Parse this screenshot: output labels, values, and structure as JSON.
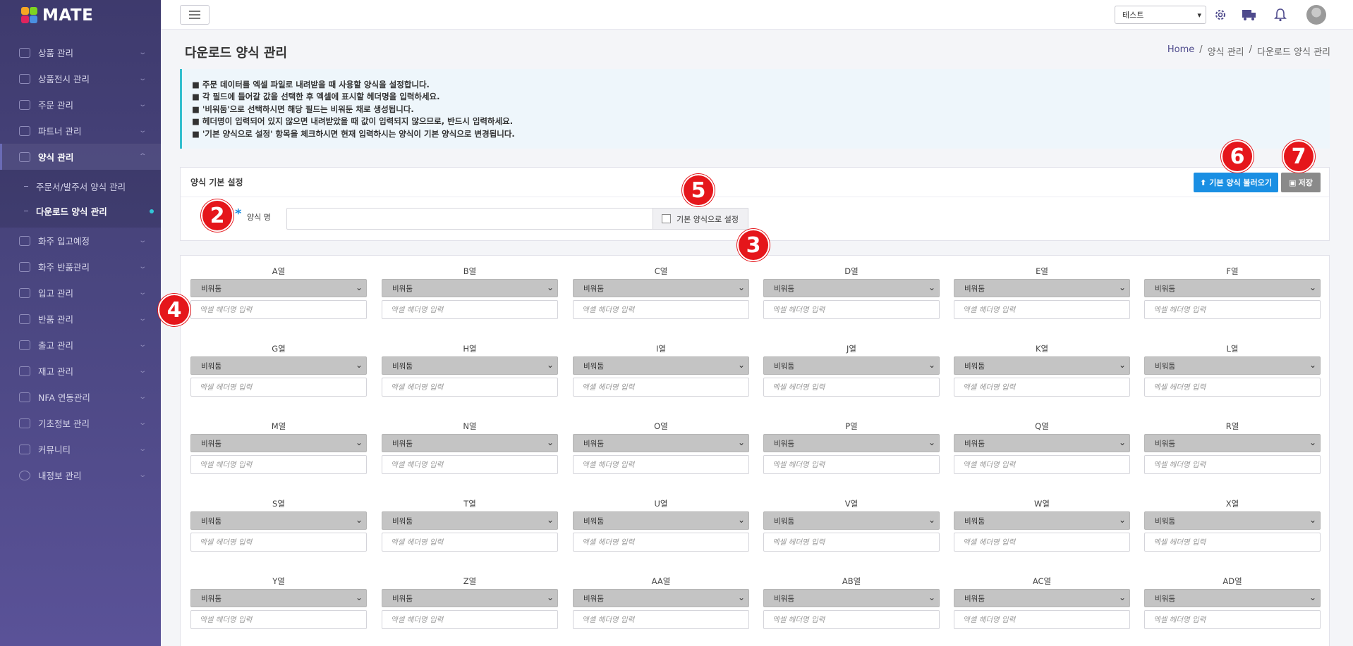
{
  "app": {
    "logo_text": "MATE"
  },
  "sidebar": {
    "items": [
      {
        "label": "상품 관리",
        "icon": "box-icon"
      },
      {
        "label": "상품전시 관리",
        "icon": "display-icon"
      },
      {
        "label": "주문 관리",
        "icon": "cart-icon"
      },
      {
        "label": "파트너 관리",
        "icon": "handshake-icon"
      },
      {
        "label": "양식 관리",
        "icon": "document-icon"
      },
      {
        "label": "화주 입고예정",
        "icon": "truck-in-icon"
      },
      {
        "label": "화주 반품관리",
        "icon": "return-icon"
      },
      {
        "label": "입고 관리",
        "icon": "inbound-icon"
      },
      {
        "label": "반품 관리",
        "icon": "exchange-icon"
      },
      {
        "label": "출고 관리",
        "icon": "truck-icon"
      },
      {
        "label": "재고 관리",
        "icon": "stock-icon"
      },
      {
        "label": "NFA 연동관리",
        "icon": "link-icon"
      },
      {
        "label": "기초정보 관리",
        "icon": "wrench-icon"
      },
      {
        "label": "커뮤니티",
        "icon": "chat-icon"
      },
      {
        "label": "내정보 관리",
        "icon": "info-icon"
      }
    ],
    "submenu": [
      {
        "label": "주문서/발주서 양식 관리"
      },
      {
        "label": "다운로드 양식 관리"
      }
    ]
  },
  "topbar": {
    "company_selected": "테스트"
  },
  "page": {
    "title": "다운로드 양식 관리",
    "breadcrumb": [
      "Home",
      "/",
      "양식 관리",
      "/",
      "다운로드 양식 관리"
    ]
  },
  "info": {
    "lines": [
      "■ 주문 데이터를 엑셀 파일로 내려받을 때 사용할 양식을 설정합니다.",
      "■ 각 필드에 들어갈 값을 선택한 후 엑셀에 표시할 헤더명을 입력하세요.",
      "■ '비워둠'으로 선택하시면 해당 필드는 비워둔 채로 생성됩니다.",
      "■ 헤더명이 입력되어 있지 않으면 내려받았을 때 값이 입력되지 않으므로, 반드시 입력하세요.",
      "■ '기본 양식으로 설정' 항목을 체크하시면 현재 입력하시는 양식이 기본 양식으로 변경됩니다."
    ]
  },
  "basic": {
    "header": "양식 기본 설정",
    "load_button": "기본 양식 불러오기",
    "save_button": "저장",
    "required_mark": "*",
    "name_label": "양식 명",
    "name_value": "",
    "default_checkbox_label": "기본 양식으로 설정"
  },
  "columns": {
    "select_value": "비워둠",
    "input_placeholder": "엑셀 헤더명 입력",
    "labels": [
      "A열",
      "B열",
      "C열",
      "D열",
      "E열",
      "F열",
      "G열",
      "H열",
      "I열",
      "J열",
      "K열",
      "L열",
      "M열",
      "N열",
      "O열",
      "P열",
      "Q열",
      "R열",
      "S열",
      "T열",
      "U열",
      "V열",
      "W열",
      "X열",
      "Y열",
      "Z열",
      "AA열",
      "AB열",
      "AC열",
      "AD열"
    ]
  },
  "markers": [
    "2",
    "3",
    "4",
    "5",
    "6",
    "7"
  ],
  "colors": {
    "sidebar": "#4a4680",
    "accent": "#1a8fe3",
    "marker": "#e5161b",
    "info_border": "#33bfce"
  }
}
